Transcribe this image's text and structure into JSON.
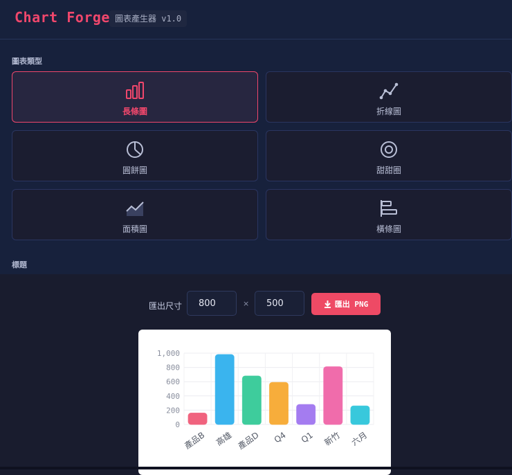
{
  "header": {
    "title": "Chart Forge",
    "version": "圖表產生器 v1.0"
  },
  "chart_types": {
    "section_label": "圖表類型",
    "items": [
      {
        "label": "長條圖",
        "icon": "bar-chart-icon",
        "active": true
      },
      {
        "label": "折線圖",
        "icon": "line-chart-icon",
        "active": false
      },
      {
        "label": "圓餅圖",
        "icon": "pie-chart-icon",
        "active": false
      },
      {
        "label": "甜甜圈",
        "icon": "donut-chart-icon",
        "active": false
      },
      {
        "label": "面積圖",
        "icon": "area-chart-icon",
        "active": false
      },
      {
        "label": "橫條圖",
        "icon": "horizontal-bar-icon",
        "active": false
      }
    ]
  },
  "title_section": {
    "label": "標題"
  },
  "export": {
    "label": "匯出尺寸",
    "width": "800",
    "height": "500",
    "times": "×",
    "button_label": "匯出 PNG",
    "button_icon": "download-icon"
  },
  "colors": {
    "accent": "#f0476c"
  },
  "chart_data": {
    "type": "bar",
    "categories": [
      "產品B",
      "高雄",
      "產品D",
      "Q4",
      "Q1",
      "新竹",
      "六月"
    ],
    "values": [
      160,
      980,
      680,
      590,
      280,
      810,
      260
    ],
    "colors": [
      "#f0637e",
      "#3ab4ee",
      "#3ecc9c",
      "#f7ad3b",
      "#a47cf0",
      "#f06cab",
      "#38c8dc"
    ],
    "ylim": [
      0,
      1000
    ],
    "yticks": [
      "0",
      "200",
      "400",
      "600",
      "800",
      "1,000"
    ],
    "grid": true
  }
}
